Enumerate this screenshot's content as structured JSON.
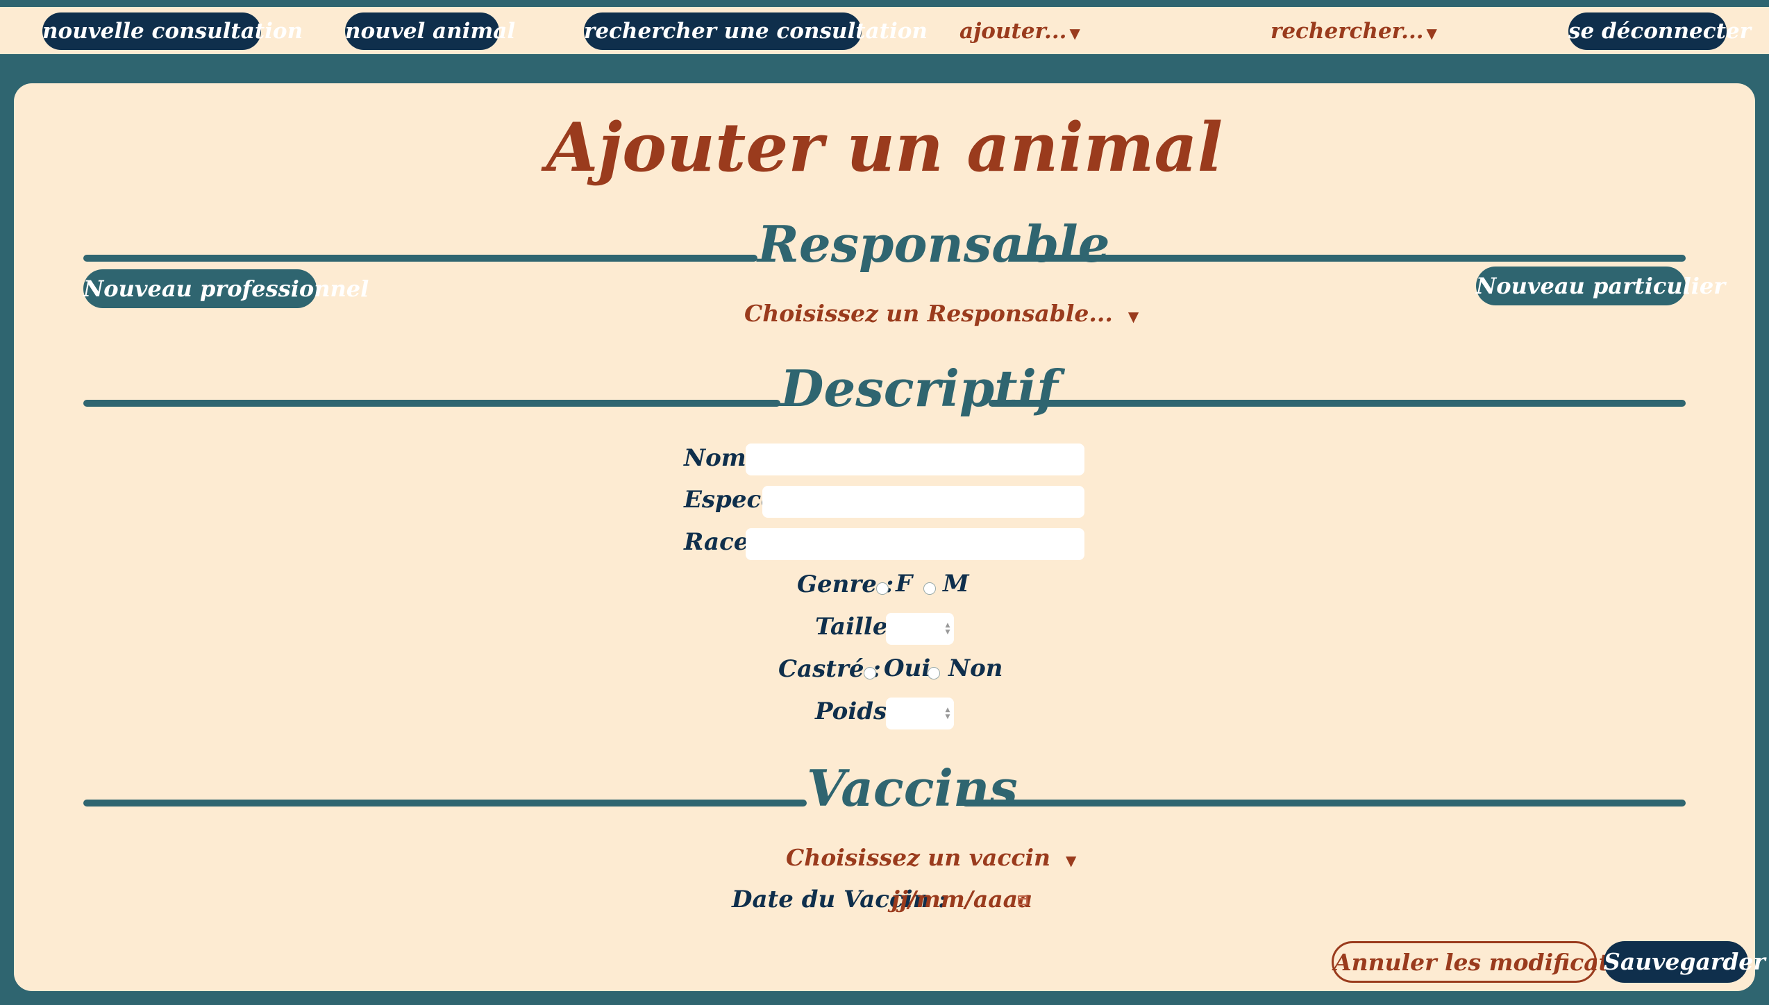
{
  "nav": {
    "new_consultation": "nouvelle consultation",
    "new_animal": "nouvel animal",
    "search_consultation": "rechercher une consultation",
    "add_menu": "ajouter...",
    "search_menu": "rechercher...",
    "logout": "se déconnecter"
  },
  "page": {
    "title": "Ajouter un animal"
  },
  "responsable": {
    "title": "Responsable",
    "new_professional": "Nouveau professionnel",
    "new_private": "Nouveau particulier",
    "select_placeholder": "Choisissez un Responsable..."
  },
  "descriptif": {
    "title": "Descriptif",
    "name_label": "Nom :",
    "species_label": "Espece :",
    "breed_label": "Race :",
    "gender_label": "Genre :",
    "gender_f": "F",
    "gender_m": "M",
    "size_label": "Taille :",
    "neutered_label": "Castré :",
    "neutered_yes": "Oui",
    "neutered_no": "Non",
    "weight_label": "Poids :"
  },
  "vaccins": {
    "title": "Vaccins",
    "select_placeholder": "Choisissez un vaccin",
    "date_label": "Date du Vaccin :",
    "date_placeholder": "jj/mm/aaaa"
  },
  "actions": {
    "cancel": "Annuler les modifications",
    "save": "Sauvegarder"
  },
  "colors": {
    "background": "#2f6570",
    "card": "#fdebd2",
    "navy": "#0f2f4c",
    "rust": "#9a3b1d"
  }
}
